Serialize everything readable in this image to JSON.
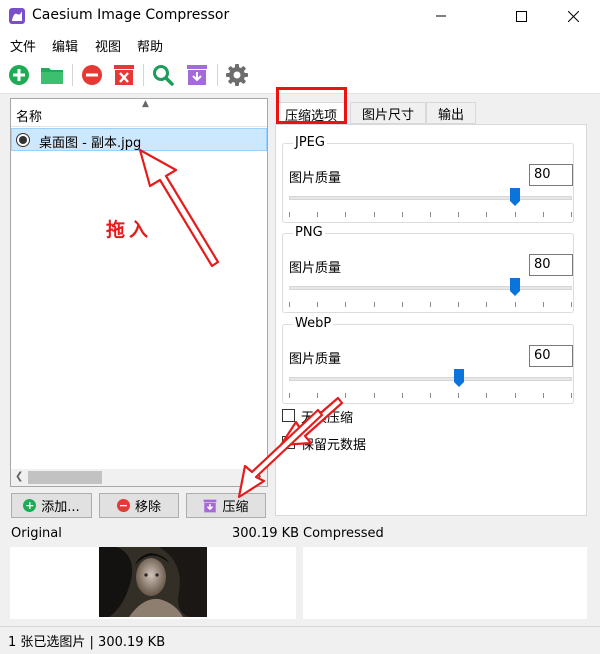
{
  "window": {
    "title": "Caesium Image Compressor"
  },
  "menu": [
    "文件",
    "编辑",
    "视图",
    "帮助"
  ],
  "toolbar": {
    "icons": [
      "add-icon",
      "folder-icon",
      "remove-icon",
      "clear-icon",
      "search-icon",
      "compress-icon",
      "settings-icon"
    ]
  },
  "file_list": {
    "header": "名称",
    "items": [
      {
        "name": "桌面图 - 副本.jpg"
      }
    ]
  },
  "buttons": {
    "add": "添加...",
    "remove": "移除",
    "compress": "压缩"
  },
  "tabs": [
    "压缩选项",
    "图片尺寸",
    "输出"
  ],
  "compression": {
    "groups": [
      {
        "title": "JPEG",
        "label": "图片质量",
        "value": "80",
        "level": 80
      },
      {
        "title": "PNG",
        "label": "图片质量",
        "value": "80",
        "level": 80
      },
      {
        "title": "WebP",
        "label": "图片质量",
        "value": "60",
        "level": 60
      }
    ],
    "options": [
      {
        "label": "无损压缩",
        "checked": false
      },
      {
        "label": "保留元数据",
        "checked": true
      }
    ]
  },
  "preview": {
    "original_label": "Original",
    "original_size": "300.19 KB",
    "compressed_label": "Compressed"
  },
  "status": {
    "text": "1 张已选图片 | 300.19 KB"
  },
  "annotation": {
    "drag_text": "拖入",
    "color": "#e51c1c"
  },
  "colors": {
    "add": "#1dab53",
    "folder": "#26a75a",
    "remove": "#e53935",
    "compress": "#a56ad7",
    "search": "#1c9d5a",
    "selection": "#cce8ff",
    "slider": "#0a74da"
  }
}
